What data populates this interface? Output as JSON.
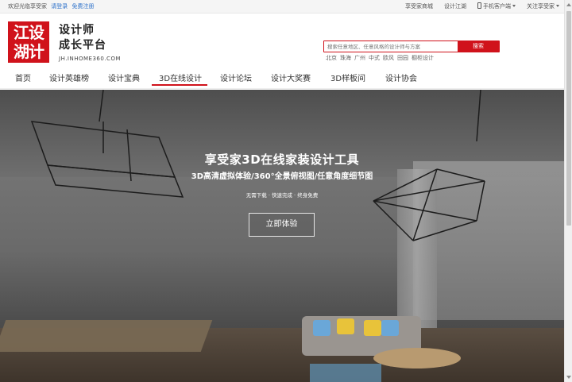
{
  "topbar": {
    "welcome": "欢迎光临享受家",
    "login": "请登录",
    "register": "免费注册",
    "links": [
      "享受家商城",
      "设计江湖"
    ],
    "mobile": "手机客户端",
    "follow": "关注享受家"
  },
  "logo": {
    "badge_line1": "江设",
    "badge_line2": "湖计",
    "line1": "设计师",
    "line2": "成长平台",
    "url": "JH.INHOME360.COM",
    "brand_color": "#d0121b"
  },
  "search": {
    "placeholder": "搜索任意地区、任意风格的设计师与方案",
    "button": "搜索",
    "hot": [
      "北京",
      "珠海",
      "广州",
      "中式",
      "欧风",
      "田园",
      "橱柜设计"
    ]
  },
  "nav": {
    "items": [
      "首页",
      "设计英雄榜",
      "设计宝典",
      "3D在线设计",
      "设计论坛",
      "设计大奖赛",
      "3D样板间",
      "设计协会"
    ],
    "active": "3D在线设计"
  },
  "hero": {
    "title": "享受家3D在线家装设计工具",
    "subtitle": "3D高清虚拟体验/360°全景俯视图/任意角度细节图",
    "tagline": "无需下载 · 快速完成 · 终身免费",
    "cta": "立即体验"
  }
}
